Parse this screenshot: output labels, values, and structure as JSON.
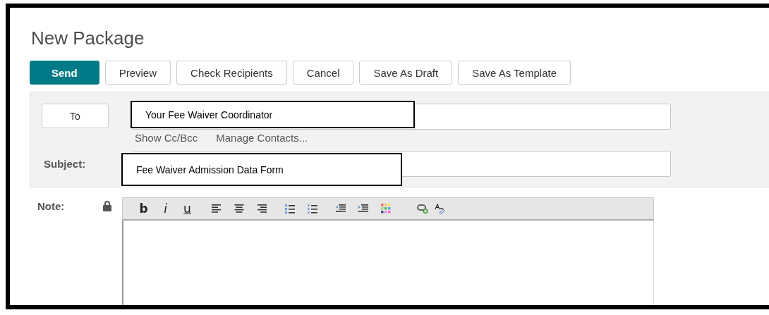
{
  "title": "New Package",
  "actions": [
    {
      "label": "Send",
      "kind": "primary"
    },
    {
      "label": "Preview",
      "kind": "secondary"
    },
    {
      "label": "Check Recipients",
      "kind": "secondary"
    },
    {
      "label": "Cancel",
      "kind": "secondary"
    },
    {
      "label": "Save As Draft",
      "kind": "secondary"
    },
    {
      "label": "Save As Template",
      "kind": "secondary"
    }
  ],
  "to": {
    "button": "To",
    "annotation": "Your Fee Waiver Coordinator",
    "links": [
      "Show Cc/Bcc",
      "Manage Contacts..."
    ]
  },
  "subject": {
    "label": "Subject:",
    "annotation": "Fee Waiver Admission Data Form"
  },
  "note": {
    "label": "Note:",
    "format_letters": [
      "b",
      "i",
      "u"
    ]
  }
}
